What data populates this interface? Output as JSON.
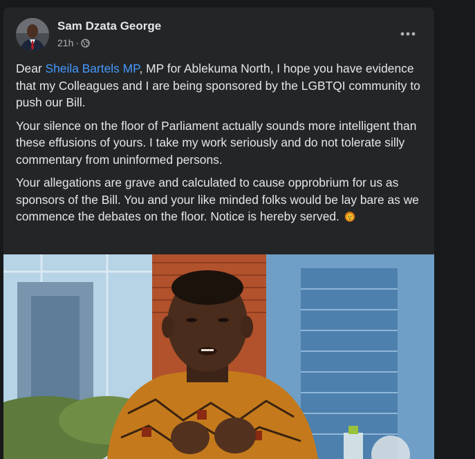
{
  "post": {
    "author": "Sam Dzata George",
    "time": "21h",
    "separator": "·",
    "privacy_icon": "globe-icon",
    "more_icon": "more-options-icon",
    "paragraph1": {
      "prefix": "Dear ",
      "mention": "Sheila Bartels MP",
      "rest": ", MP for Ablekuma North, I hope you have evidence that my Colleagues and I are being sponsored by the LGBTQI community to push our Bill."
    },
    "paragraph2": "Your silence on the floor of Parliament actually sounds more intelligent than these effusions of yours. I take my work seriously and do not tolerate silly commentary from uninformed persons.",
    "paragraph3": "Your allegations are grave and calculated to cause opprobrium for us as sponsors of the Bill. You and your like minded folks would be lay bare as we commence the debates on the floor. Notice is hereby served.",
    "emoji": "lion-face-emoji",
    "photo_icon": "post-photo"
  },
  "colors": {
    "page_bg": "#18191a",
    "card_bg": "#242526",
    "text_primary": "#e4e6eb",
    "text_secondary": "#b0b3b8",
    "link": "#4599ff"
  }
}
